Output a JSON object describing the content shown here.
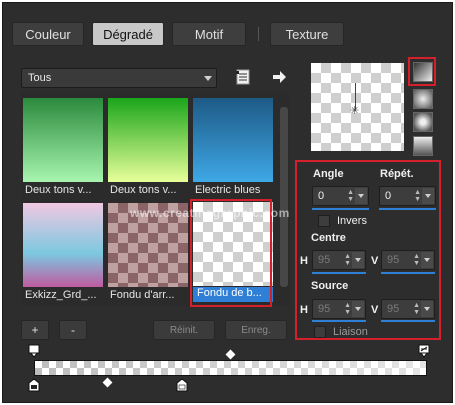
{
  "tabs": [
    {
      "label": "Couleur"
    },
    {
      "label": "Dégradé",
      "active": true
    },
    {
      "label": "Motif"
    },
    {
      "label": "Texture"
    }
  ],
  "category_select": {
    "value": "Tous"
  },
  "gradients": [
    {
      "label": "Deux tons v...",
      "colors": [
        "#2a8a3c",
        "#a8f5b0"
      ]
    },
    {
      "label": "Deux tons v...",
      "colors": [
        "#1aa51a",
        "#e8ff9a"
      ]
    },
    {
      "label": "Electric blues",
      "colors": [
        "#1d5a86",
        "#3fa8e6"
      ]
    },
    {
      "label": "Exkizz_Grd_...",
      "colors": [
        "#f0c8e2",
        "#7cc8e0",
        "#c05aa0"
      ]
    },
    {
      "label": "Fondu d'arr...",
      "colors": [
        "#9c6e72",
        "#d9b6b6"
      ]
    },
    {
      "label": "Fondu de b...",
      "selected": true
    }
  ],
  "list_buttons": {
    "add": "+",
    "remove": "-",
    "reset": "Réinit.",
    "save": "Enreg."
  },
  "settings": {
    "angle_label": "Angle",
    "angle_value": "0",
    "repeat_label": "Répét.",
    "repeat_value": "0",
    "invert_label": "Invers",
    "center_label": "Centre",
    "center_h": "95",
    "center_v": "95",
    "source_label": "Source",
    "source_h": "95",
    "source_v": "95",
    "link_label": "Liaison",
    "h_label": "H",
    "v_label": "V"
  },
  "watermark": "www.creatinegraphic.com",
  "colors": {
    "accent_blue": "#2f7fd6",
    "highlight_red": "#d3202a",
    "panel_bg": "#2d2d2d"
  }
}
